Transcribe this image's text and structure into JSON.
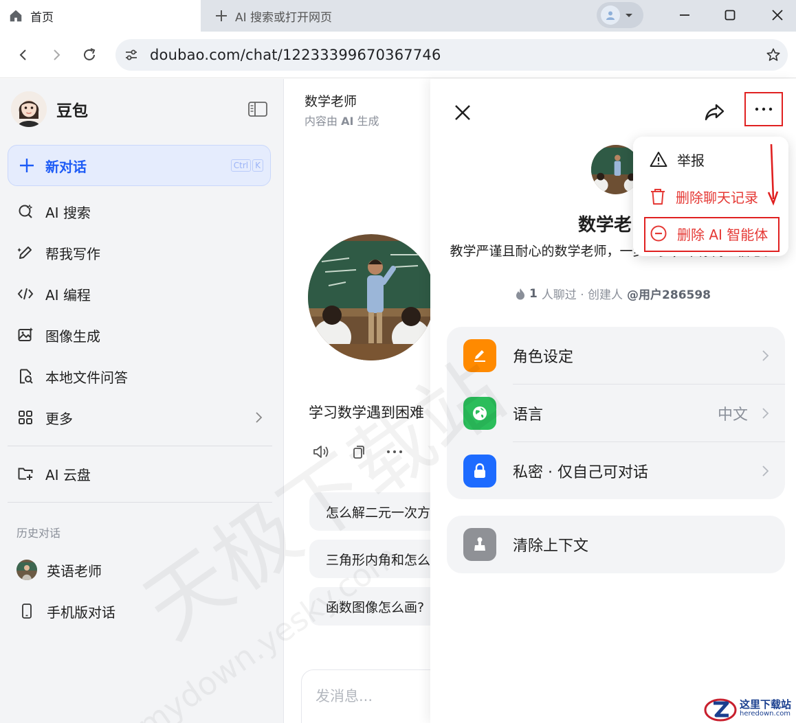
{
  "browser": {
    "active_tab": "首页",
    "new_tab": "AI 搜索或打开网页",
    "url": "doubao.com/chat/12233399670367746"
  },
  "sidebar": {
    "brand": "豆包",
    "new_chat": "新对话",
    "shortcut": [
      "Ctrl",
      "K"
    ],
    "items": [
      {
        "label": "AI 搜索",
        "icon": "ai-search-icon"
      },
      {
        "label": "帮我写作",
        "icon": "pen-sparkle-icon"
      },
      {
        "label": "AI 编程",
        "icon": "code-icon"
      },
      {
        "label": "图像生成",
        "icon": "image-icon"
      },
      {
        "label": "本地文件问答",
        "icon": "file-search-icon"
      },
      {
        "label": "更多",
        "icon": "grid-icon"
      }
    ],
    "cloud": "AI 云盘",
    "history_title": "历史对话",
    "history": [
      {
        "label": "英语老师"
      },
      {
        "label": "手机版对话"
      }
    ]
  },
  "chat": {
    "title": "数学老师",
    "subtitle_prefix": "内容由 ",
    "subtitle_ai": "AI",
    "subtitle_suffix": " 生成",
    "greeting": "学习数学遇到困难",
    "suggestions": [
      "怎么解二元一次方",
      "三角形内角和怎么",
      "函数图像怎么画?"
    ],
    "input_placeholder": "发消息..."
  },
  "panel": {
    "name": "数学老",
    "description": "教学严谨且耐心的数学老师，一步一步，帮你树立信心。",
    "description_line2": "树立信心。",
    "meta_count": "1",
    "meta_text": "人聊过 · 创建人 ",
    "meta_creator": "@用户286598",
    "rows": [
      {
        "label": "角色设定",
        "value": "",
        "color": "#ff8a00"
      },
      {
        "label": "语言",
        "value": "中文",
        "color": "#2bbd5b"
      },
      {
        "label": "私密 · 仅自己可对话",
        "value": "",
        "color": "#1d6bff"
      }
    ],
    "clear": {
      "label": "清除上下文",
      "color": "#8f9196"
    }
  },
  "dropdown": {
    "items": [
      {
        "label": "举报",
        "color": "#1f1f1f"
      },
      {
        "label": "删除聊天记录",
        "color": "#e53935"
      },
      {
        "label": "删除 AI 智能体",
        "color": "#e53935"
      }
    ]
  },
  "watermark": {
    "big": "天极下载站",
    "small": "mydown.yesky.com",
    "logo_cn": "这里下载站",
    "logo_en": "heredown.com"
  }
}
